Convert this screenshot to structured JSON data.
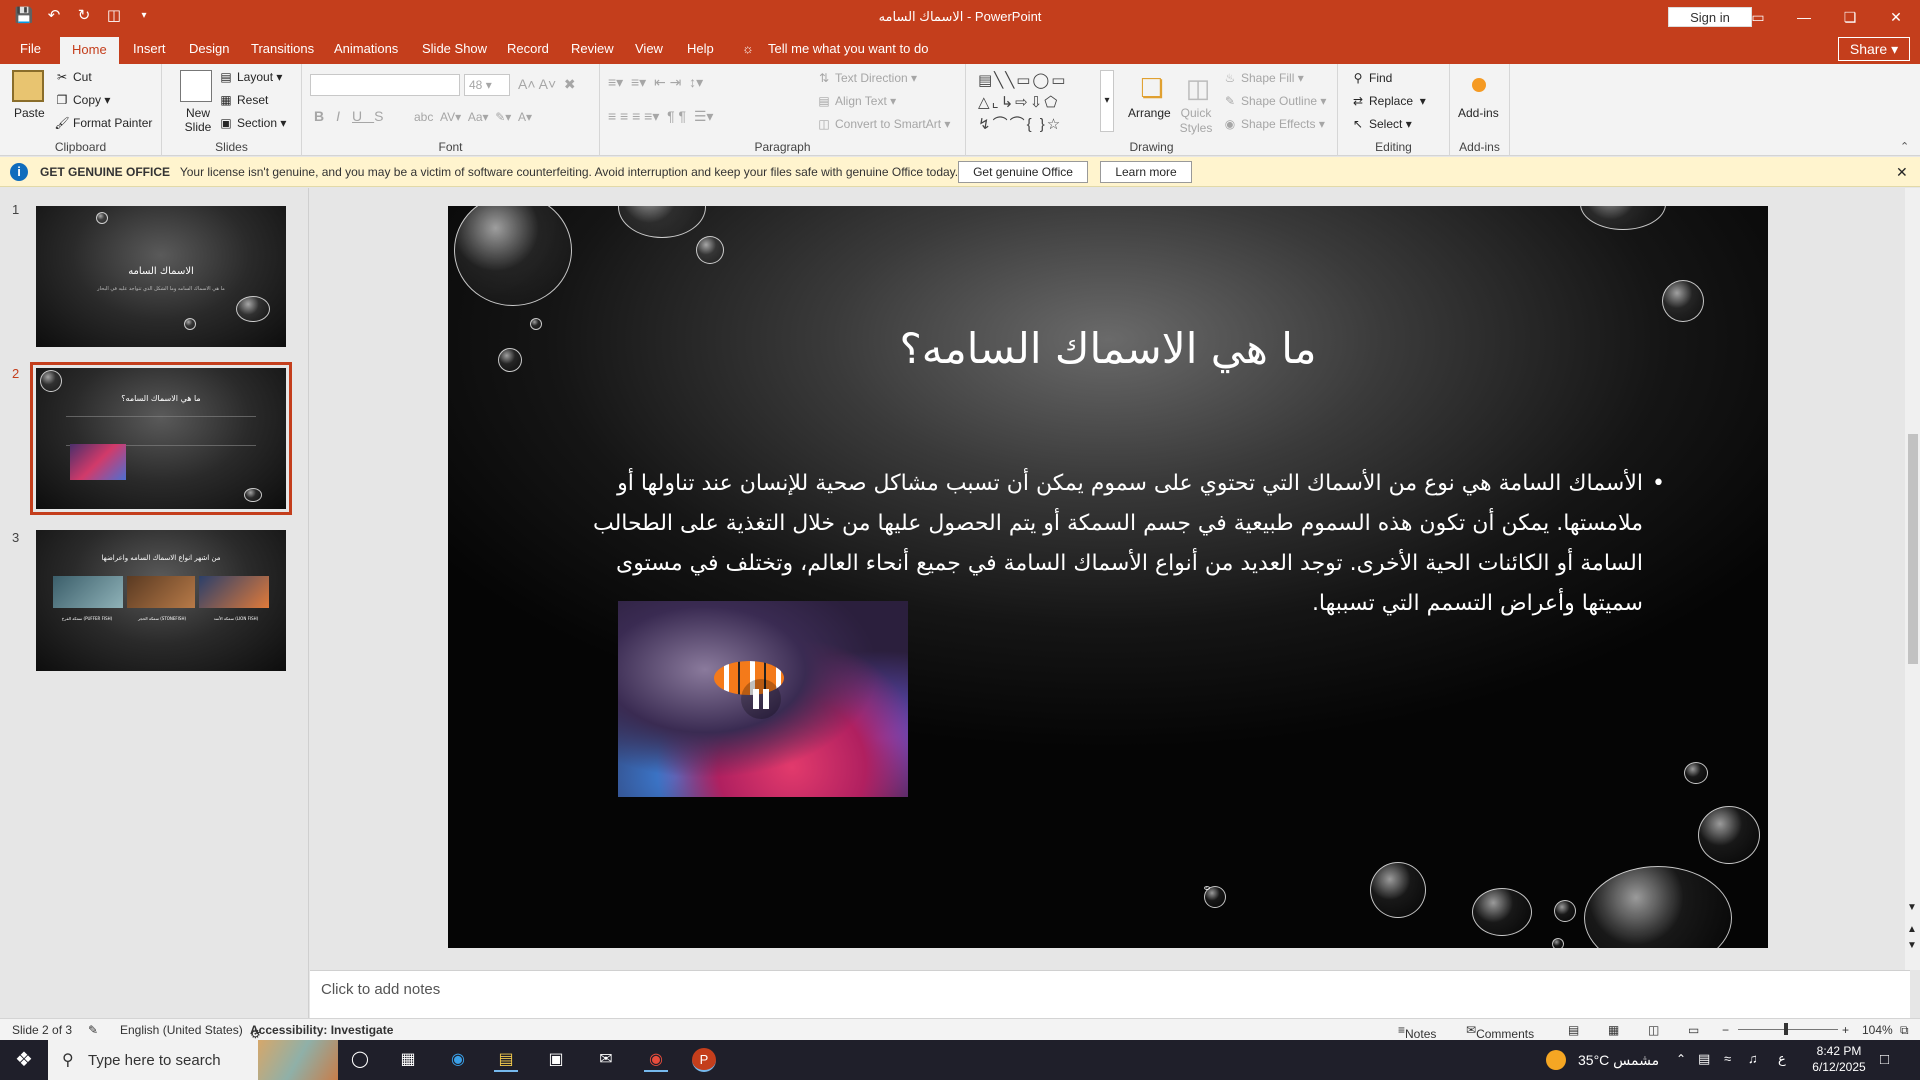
{
  "window": {
    "title": "الاسماك السامه  -  PowerPoint",
    "signin": "Sign in"
  },
  "tabs": [
    "File",
    "Home",
    "Insert",
    "Design",
    "Transitions",
    "Animations",
    "Slide Show",
    "Record",
    "Review",
    "View",
    "Help"
  ],
  "active_tab": "Home",
  "tell_me": "Tell me what you want to do",
  "share": "Share",
  "ribbon": {
    "clipboard": {
      "label": "Clipboard",
      "paste": "Paste",
      "cut": "Cut",
      "copy": "Copy",
      "format_painter": "Format Painter"
    },
    "slides": {
      "label": "Slides",
      "new_slide": "New Slide",
      "layout": "Layout",
      "reset": "Reset",
      "section": "Section"
    },
    "font": {
      "label": "Font",
      "size": "48"
    },
    "paragraph": {
      "label": "Paragraph",
      "text_direction": "Text Direction",
      "align_text": "Align Text",
      "convert_smartart": "Convert to SmartArt"
    },
    "drawing": {
      "label": "Drawing",
      "arrange": "Arrange",
      "quick_styles": "Quick Styles",
      "shape_fill": "Shape Fill",
      "shape_outline": "Shape Outline",
      "shape_effects": "Shape Effects"
    },
    "editing": {
      "label": "Editing",
      "find": "Find",
      "replace": "Replace",
      "select": "Select"
    },
    "addins": {
      "label": "Add-ins",
      "addins": "Add-ins"
    }
  },
  "license_bar": {
    "heading": "GET GENUINE OFFICE",
    "message": "Your license isn't genuine, and you may be a victim of software counterfeiting. Avoid interruption and keep your files safe with genuine Office today.",
    "btn_genuine": "Get genuine Office",
    "btn_learn": "Learn more"
  },
  "thumbnails": [
    {
      "num": "1",
      "title": "الاسماك السامه",
      "subtitle": "ما هي الاسماك السامه وما الشكل الذي تتواجد عليه في البحار"
    },
    {
      "num": "2",
      "title": "ما هي الاسماك السامه؟"
    },
    {
      "num": "3",
      "title": "من اشهر انواع الاسماك السامه واعراضها",
      "captions": [
        "سمكة الأسد (LION FISH)",
        "سمكة الحجر (STONEFISH)",
        "سمكة الفرخ (PUFFER FISH)"
      ]
    }
  ],
  "slide": {
    "title": "ما هي الاسماك السامه؟",
    "body": "الأسماك السامة هي نوع من الأسماك التي تحتوي على سموم يمكن أن تسبب مشاكل صحية للإنسان عند تناولها أو ملامستها. يمكن أن تكون هذه السموم طبيعية في جسم السمكة أو يتم الحصول عليها من خلال التغذية على الطحالب السامة أو الكائنات الحية الأخرى. توجد العديد من أنواع الأسماك السامة في جميع أنحاء العالم، وتختلف في مستوى سميتها وأعراض التسمم التي تسببها."
  },
  "notes_placeholder": "Click to add notes",
  "status": {
    "slide": "Slide 2 of 3",
    "language": "English (United States)",
    "accessibility": "Accessibility: Investigate",
    "notes": "Notes",
    "comments": "Comments",
    "zoom": "104%"
  },
  "taskbar": {
    "search_placeholder": "Type here to search",
    "weather": "35°C  مشمس",
    "lang": "ع",
    "time": "8:42 PM",
    "date": "6/12/2025"
  }
}
